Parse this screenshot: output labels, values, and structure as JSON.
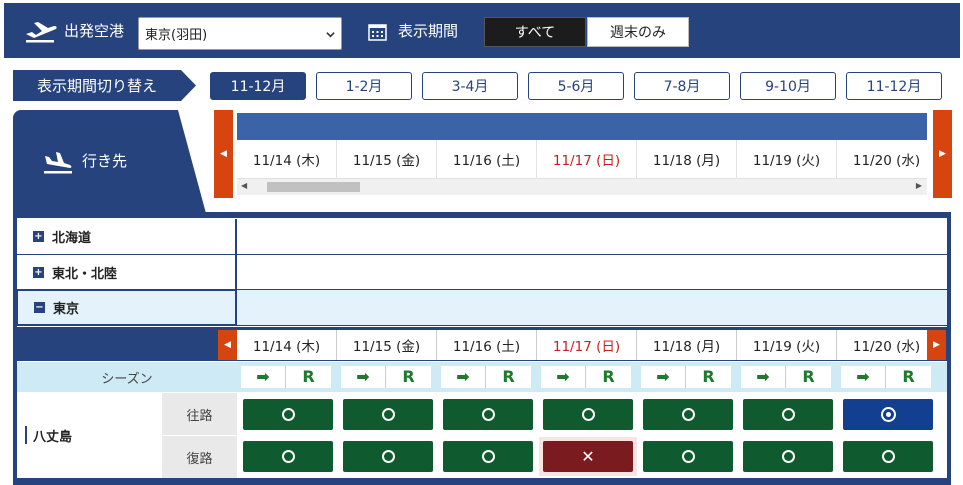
{
  "topbar": {
    "departure_label": "出発空港",
    "airport_selected": "東京(羽田)",
    "period_label": "表示期間",
    "filter_all": "すべて",
    "filter_weekend": "週末のみ"
  },
  "period": {
    "switch_label": "表示期間切り替え",
    "tabs": [
      "11-12月",
      "1-2月",
      "3-4月",
      "5-6月",
      "7-8月",
      "9-10月",
      "11-12月"
    ],
    "active_index": 0
  },
  "destination_label": "行き先",
  "dates": [
    {
      "label": "11/14 (木)",
      "sunday": false
    },
    {
      "label": "11/15 (金)",
      "sunday": false
    },
    {
      "label": "11/16 (土)",
      "sunday": false
    },
    {
      "label": "11/17 (日)",
      "sunday": true
    },
    {
      "label": "11/18 (月)",
      "sunday": false
    },
    {
      "label": "11/19 (火)",
      "sunday": false
    },
    {
      "label": "11/20 (水)",
      "sunday": false
    }
  ],
  "regions": [
    {
      "name": "北海道",
      "expanded": false,
      "toggle": "+"
    },
    {
      "name": "東北・北陸",
      "expanded": false,
      "toggle": "+"
    },
    {
      "name": "東京",
      "expanded": true,
      "toggle": "−"
    }
  ],
  "season": {
    "label": "シーズン",
    "arrow_symbol": "➡",
    "r_symbol": "R"
  },
  "route": {
    "name": "八丈島",
    "outbound_label": "往路",
    "return_label": "復路",
    "outbound": [
      "ok",
      "ok",
      "ok",
      "ok",
      "ok",
      "ok",
      "few"
    ],
    "return": [
      "ok",
      "ok",
      "ok",
      "full",
      "ok",
      "ok",
      "ok"
    ]
  },
  "colors": {
    "navy": "#26437d",
    "available": "#0f5b2f",
    "full": "#7a1c1f",
    "few": "#123f8f",
    "sunday_text": "#c8201c",
    "nav_arrow": "#d64510"
  }
}
